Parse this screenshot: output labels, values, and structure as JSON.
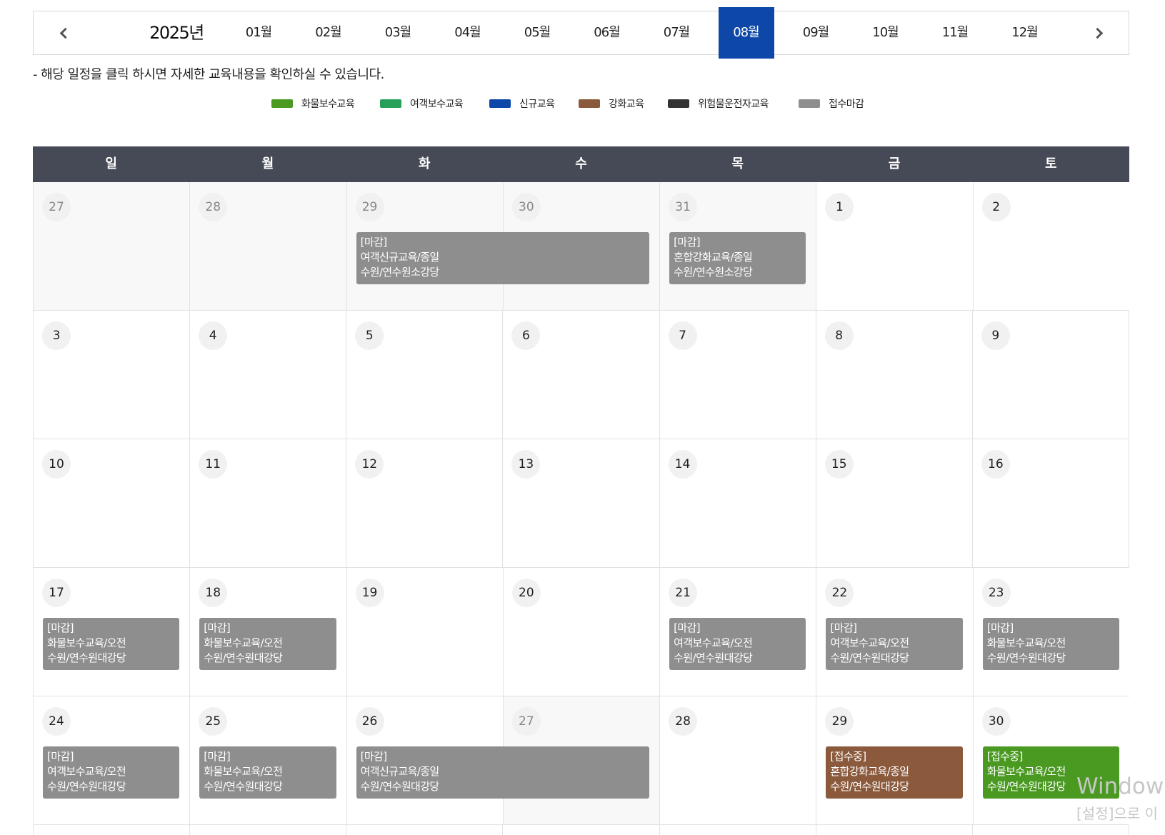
{
  "nav": {
    "year": "2025년",
    "months": [
      "01월",
      "02월",
      "03월",
      "04월",
      "05월",
      "06월",
      "07월",
      "08월",
      "09월",
      "10월",
      "11월",
      "12월"
    ],
    "active_month": "08월"
  },
  "notice": "- 해당 일정을 클릭 하시면 자세한 교육내용을 확인하실 수 있습니다.",
  "legend": [
    {
      "label": "화물보수교육",
      "color": "#4a9a22"
    },
    {
      "label": "여객보수교육",
      "color": "#27a05a"
    },
    {
      "label": "신규교육",
      "color": "#0d47a8"
    },
    {
      "label": "강화교육",
      "color": "#8b5a3c"
    },
    {
      "label": "위험물운전자교육",
      "color": "#333333"
    },
    {
      "label": "접수마감",
      "color": "#8e8e8e"
    }
  ],
  "weekdays": [
    "일",
    "월",
    "화",
    "수",
    "목",
    "금",
    "토"
  ],
  "weeks": [
    [
      "27",
      "28",
      "29",
      "30",
      "31",
      "1",
      "2"
    ],
    [
      "3",
      "4",
      "5",
      "6",
      "7",
      "8",
      "9"
    ],
    [
      "10",
      "11",
      "12",
      "13",
      "14",
      "15",
      "16"
    ],
    [
      "17",
      "18",
      "19",
      "20",
      "21",
      "22",
      "23"
    ],
    [
      "24",
      "25",
      "26",
      "27",
      "28",
      "29",
      "30"
    ]
  ],
  "events": [
    {
      "week": 0,
      "start": 2,
      "span": 2,
      "status": "[마감]",
      "title": "여객신규교육/종일",
      "place": "수원/연수원소강당",
      "color": "#8e8e8e"
    },
    {
      "week": 0,
      "start": 4,
      "span": 1,
      "status": "[마감]",
      "title": "혼합강화교육/종일",
      "place": "수원/연수원소강당",
      "color": "#8e8e8e"
    },
    {
      "week": 3,
      "start": 0,
      "span": 1,
      "status": "[마감]",
      "title": "화물보수교육/오전",
      "place": "수원/연수원대강당",
      "color": "#8e8e8e"
    },
    {
      "week": 3,
      "start": 1,
      "span": 1,
      "status": "[마감]",
      "title": "화물보수교육/오전",
      "place": "수원/연수원대강당",
      "color": "#8e8e8e"
    },
    {
      "week": 3,
      "start": 4,
      "span": 1,
      "status": "[마감]",
      "title": "여객보수교육/오전",
      "place": "수원/연수원대강당",
      "color": "#8e8e8e"
    },
    {
      "week": 3,
      "start": 5,
      "span": 1,
      "status": "[마감]",
      "title": "여객보수교육/오전",
      "place": "수원/연수원대강당",
      "color": "#8e8e8e"
    },
    {
      "week": 3,
      "start": 6,
      "span": 1,
      "status": "[마감]",
      "title": "화물보수교육/오전",
      "place": "수원/연수원대강당",
      "color": "#8e8e8e"
    },
    {
      "week": 4,
      "start": 0,
      "span": 1,
      "status": "[마감]",
      "title": "여객보수교육/오전",
      "place": "수원/연수원대강당",
      "color": "#8e8e8e"
    },
    {
      "week": 4,
      "start": 1,
      "span": 1,
      "status": "[마감]",
      "title": "화물보수교육/오전",
      "place": "수원/연수원대강당",
      "color": "#8e8e8e"
    },
    {
      "week": 4,
      "start": 2,
      "span": 2,
      "status": "[마감]",
      "title": "여객신규교육/종일",
      "place": "수원/연수원대강당",
      "color": "#8e8e8e"
    },
    {
      "week": 4,
      "start": 5,
      "span": 1,
      "status": "[접수중]",
      "title": "혼합강화교육/종일",
      "place": "수원/연수원대강당",
      "color": "#8b5a3c"
    },
    {
      "week": 4,
      "start": 6,
      "span": 1,
      "status": "[접수중]",
      "title": "화물보수교육/오전",
      "place": "수원/연수원대강당",
      "color": "#4a9a22"
    }
  ],
  "watermark": {
    "line1": "Windows",
    "line2": "[설정]으로 이"
  }
}
